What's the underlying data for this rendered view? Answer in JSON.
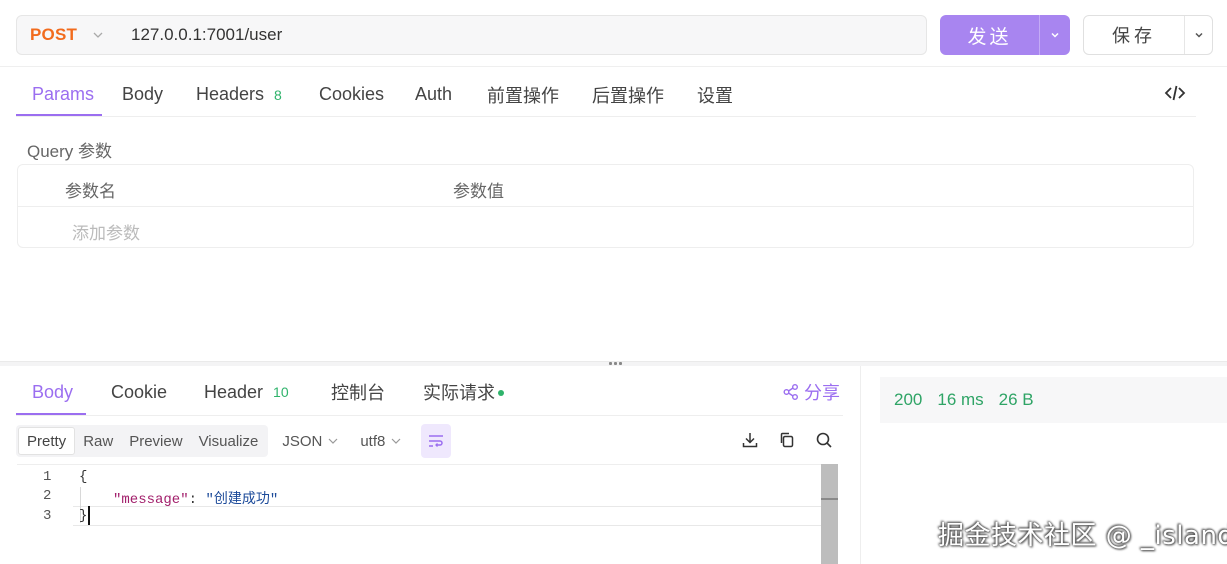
{
  "request": {
    "method": "POST",
    "url": "127.0.0.1:7001/user",
    "send_label": "发送",
    "save_label": "保存"
  },
  "request_tabs": {
    "params": "Params",
    "body": "Body",
    "headers": "Headers",
    "headers_count": "8",
    "cookies": "Cookies",
    "auth": "Auth",
    "pre_ops": "前置操作",
    "post_ops": "后置操作",
    "settings": "设置",
    "active": "Params"
  },
  "params": {
    "section_label": "Query 参数",
    "col_name": "参数名",
    "col_value": "参数值",
    "add_placeholder": "添加参数"
  },
  "response_tabs": {
    "body": "Body",
    "cookie": "Cookie",
    "header": "Header",
    "header_count": "10",
    "console": "控制台",
    "actual_request": "实际请求",
    "share": "分享",
    "active": "Body"
  },
  "view_toolbar": {
    "modes": [
      "Pretty",
      "Raw",
      "Preview",
      "Visualize"
    ],
    "active_mode": "Pretty",
    "format": "JSON",
    "encoding": "utf8"
  },
  "editor": {
    "line_numbers": [
      "1",
      "2",
      "3"
    ],
    "line1": "{",
    "line2_key": "\"message\"",
    "line2_colon": ": ",
    "line2_value": "\"创建成功\"",
    "line3": "}"
  },
  "stats": {
    "status": "200",
    "time": "16 ms",
    "size": "26 B"
  },
  "watermark": "掘金技术社区 @ _island",
  "colors": {
    "accent": "#9b6ef0",
    "send_button": "#a885f0",
    "method": "#f26b1d",
    "success": "#2fa466"
  }
}
